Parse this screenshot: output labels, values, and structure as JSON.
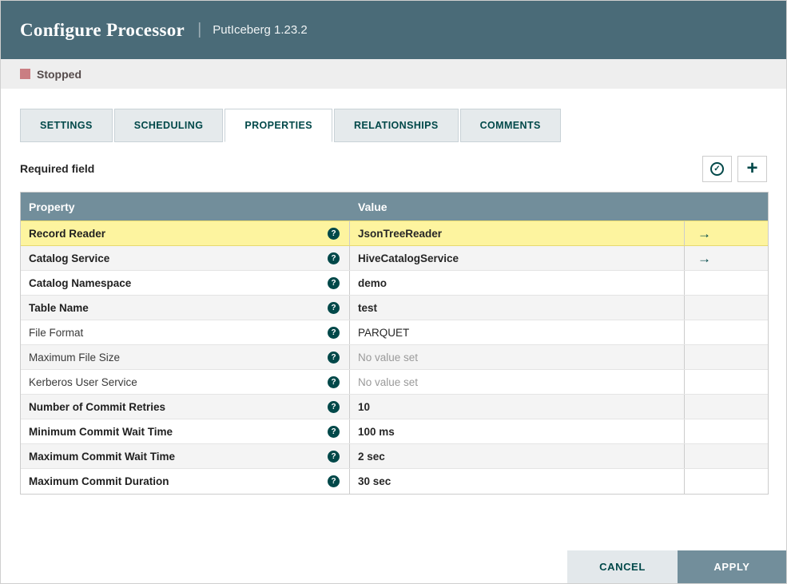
{
  "header": {
    "title": "Configure Processor",
    "separator": "|",
    "subtitle": "PutIceberg 1.23.2"
  },
  "status": {
    "label": "Stopped"
  },
  "tabs": [
    {
      "label": "SETTINGS",
      "active": false
    },
    {
      "label": "SCHEDULING",
      "active": false
    },
    {
      "label": "PROPERTIES",
      "active": true
    },
    {
      "label": "RELATIONSHIPS",
      "active": false
    },
    {
      "label": "COMMENTS",
      "active": false
    }
  ],
  "properties_panel": {
    "required_field_label": "Required field",
    "table": {
      "columns": {
        "property": "Property",
        "value": "Value"
      },
      "rows": [
        {
          "property": "Record Reader",
          "required": true,
          "value": "JsonTreeReader",
          "placeholder": false,
          "goto": true,
          "highlight": true
        },
        {
          "property": "Catalog Service",
          "required": true,
          "value": "HiveCatalogService",
          "placeholder": false,
          "goto": true,
          "highlight": false
        },
        {
          "property": "Catalog Namespace",
          "required": true,
          "value": "demo",
          "placeholder": false,
          "goto": false,
          "highlight": false
        },
        {
          "property": "Table Name",
          "required": true,
          "value": "test",
          "placeholder": false,
          "goto": false,
          "highlight": false
        },
        {
          "property": "File Format",
          "required": false,
          "value": "PARQUET",
          "placeholder": false,
          "goto": false,
          "highlight": false
        },
        {
          "property": "Maximum File Size",
          "required": false,
          "value": "No value set",
          "placeholder": true,
          "goto": false,
          "highlight": false
        },
        {
          "property": "Kerberos User Service",
          "required": false,
          "value": "No value set",
          "placeholder": true,
          "goto": false,
          "highlight": false
        },
        {
          "property": "Number of Commit Retries",
          "required": true,
          "value": "10",
          "placeholder": false,
          "goto": false,
          "highlight": false
        },
        {
          "property": "Minimum Commit Wait Time",
          "required": true,
          "value": "100 ms",
          "placeholder": false,
          "goto": false,
          "highlight": false
        },
        {
          "property": "Maximum Commit Wait Time",
          "required": true,
          "value": "2 sec",
          "placeholder": false,
          "goto": false,
          "highlight": false
        },
        {
          "property": "Maximum Commit Duration",
          "required": true,
          "value": "30 sec",
          "placeholder": false,
          "goto": false,
          "highlight": false
        }
      ]
    }
  },
  "footer": {
    "cancel_label": "CANCEL",
    "apply_label": "APPLY"
  },
  "icons": {
    "verify": "✓",
    "add": "+",
    "help": "?",
    "goto": "→"
  },
  "colors": {
    "accent": "#004849",
    "header_bg": "#4a6b78",
    "table_header_bg": "#728e9b",
    "highlight_bg": "#fdf49f",
    "stopped_color": "#ca7e82",
    "apply_bg": "#728e9b"
  }
}
